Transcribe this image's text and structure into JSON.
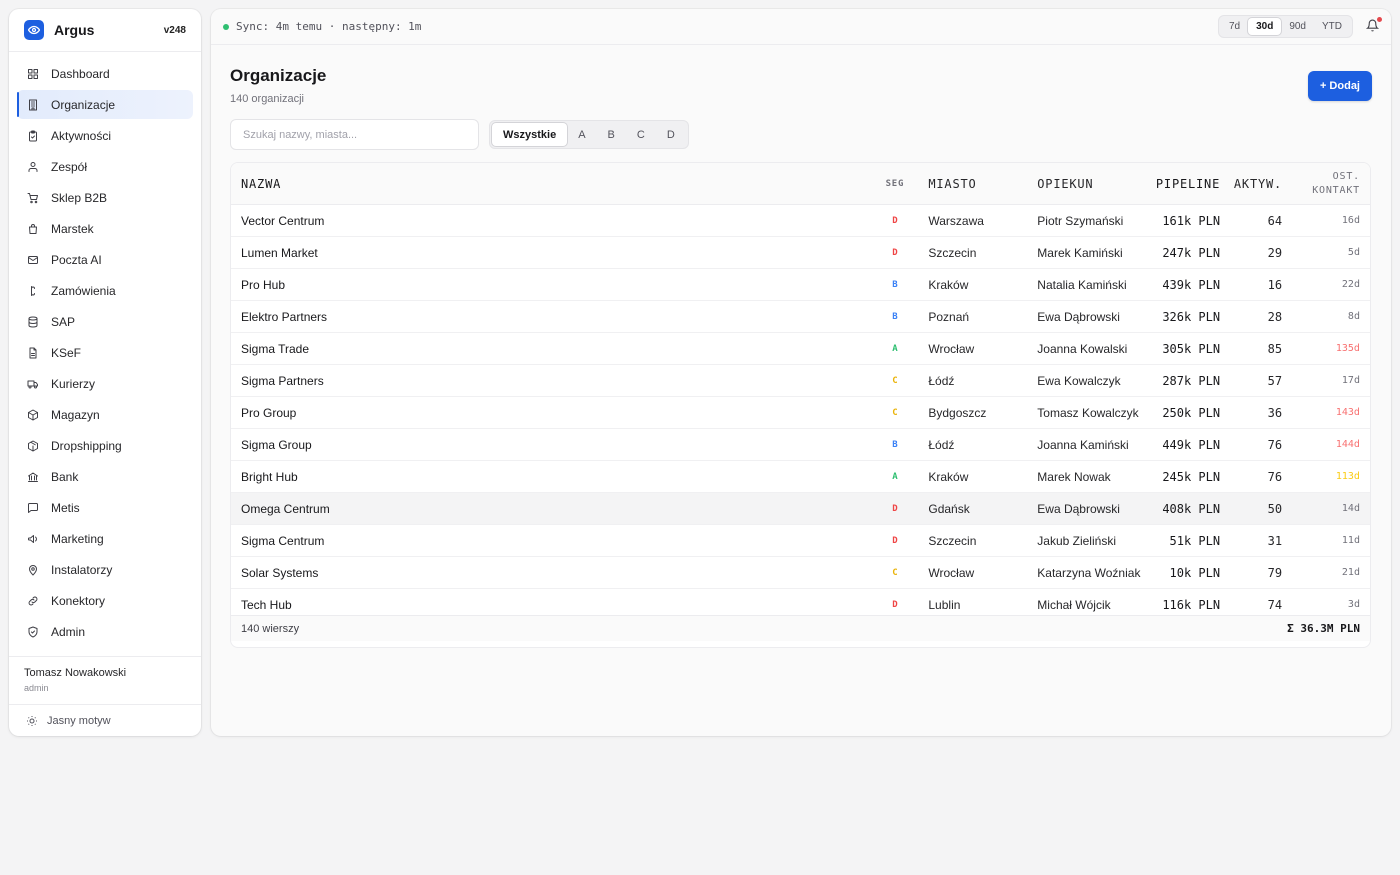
{
  "brand": {
    "name": "Argus",
    "version": "v248"
  },
  "sidebar": {
    "items": [
      {
        "label": "Dashboard",
        "icon": "grid-icon"
      },
      {
        "label": "Organizacje",
        "icon": "building-icon",
        "active": true
      },
      {
        "label": "Aktywności",
        "icon": "clipboard-icon"
      },
      {
        "label": "Zespół",
        "icon": "users-icon"
      },
      {
        "label": "Sklep B2B",
        "icon": "cart-icon"
      },
      {
        "label": "Marstek",
        "icon": "bag-icon"
      },
      {
        "label": "Poczta AI",
        "icon": "mail-icon"
      },
      {
        "label": "Zamówienia",
        "icon": "receipt-icon"
      },
      {
        "label": "SAP",
        "icon": "database-icon"
      },
      {
        "label": "KSeF",
        "icon": "file-icon"
      },
      {
        "label": "Kurierzy",
        "icon": "truck-icon"
      },
      {
        "label": "Magazyn",
        "icon": "box-icon"
      },
      {
        "label": "Dropshipping",
        "icon": "package-icon"
      },
      {
        "label": "Bank",
        "icon": "bank-icon"
      },
      {
        "label": "Metis",
        "icon": "chat-icon"
      },
      {
        "label": "Marketing",
        "icon": "megaphone-icon"
      },
      {
        "label": "Instalatorzy",
        "icon": "pin-icon"
      },
      {
        "label": "Konektory",
        "icon": "link-icon"
      },
      {
        "label": "Admin",
        "icon": "shield-icon"
      }
    ]
  },
  "user": {
    "name": "Tomasz Nowakowski",
    "role": "admin"
  },
  "theme_toggle": "Jasny motyw",
  "topbar": {
    "sync": "Sync: 4m temu · następny: 1m",
    "ranges": [
      "7d",
      "30d",
      "90d",
      "YTD"
    ],
    "selected_range": "30d"
  },
  "page": {
    "title": "Organizacje",
    "subtitle": "140 organizacji",
    "add_label": "+ Dodaj",
    "search_placeholder": "Szukaj nazwy, miasta...",
    "segments": [
      "Wszystkie",
      "A",
      "B",
      "C",
      "D"
    ],
    "selected_segment": "Wszystkie"
  },
  "colors": {
    "accent": "#1d5fe0",
    "seg_A": "#2fbf71",
    "seg_B": "#3b82f6",
    "seg_C": "#eab308",
    "seg_D": "#ef4444",
    "stale_red": "#f87171",
    "stale_amber": "#facc15"
  },
  "table": {
    "headers": {
      "name": "NAZWA",
      "seg": "SEG",
      "city": "MIASTO",
      "owner": "OPIEKUN",
      "pipeline": "PIPELINE",
      "activity": "AKTYW.",
      "last_contact_1": "OST.",
      "last_contact_2": "KONTAKT"
    },
    "rows": [
      {
        "name": "Vector Centrum",
        "seg": "D",
        "city": "Warszawa",
        "owner": "Piotr Szymański",
        "pipeline": "161k PLN",
        "activity": "64",
        "last": "16d",
        "status": "normal"
      },
      {
        "name": "Lumen Market",
        "seg": "D",
        "city": "Szczecin",
        "owner": "Marek Kamiński",
        "pipeline": "247k PLN",
        "activity": "29",
        "last": "5d",
        "status": "normal"
      },
      {
        "name": "Pro Hub",
        "seg": "B",
        "city": "Kraków",
        "owner": "Natalia Kamiński",
        "pipeline": "439k PLN",
        "activity": "16",
        "last": "22d",
        "status": "normal"
      },
      {
        "name": "Elektro Partners",
        "seg": "B",
        "city": "Poznań",
        "owner": "Ewa Dąbrowski",
        "pipeline": "326k PLN",
        "activity": "28",
        "last": "8d",
        "status": "normal"
      },
      {
        "name": "Sigma Trade",
        "seg": "A",
        "city": "Wrocław",
        "owner": "Joanna Kowalski",
        "pipeline": "305k PLN",
        "activity": "85",
        "last": "135d",
        "status": "red"
      },
      {
        "name": "Sigma Partners",
        "seg": "C",
        "city": "Łódź",
        "owner": "Ewa Kowalczyk",
        "pipeline": "287k PLN",
        "activity": "57",
        "last": "17d",
        "status": "normal"
      },
      {
        "name": "Pro Group",
        "seg": "C",
        "city": "Bydgoszcz",
        "owner": "Tomasz Kowalczyk",
        "pipeline": "250k PLN",
        "activity": "36",
        "last": "143d",
        "status": "red"
      },
      {
        "name": "Sigma Group",
        "seg": "B",
        "city": "Łódź",
        "owner": "Joanna Kamiński",
        "pipeline": "449k PLN",
        "activity": "76",
        "last": "144d",
        "status": "red"
      },
      {
        "name": "Bright Hub",
        "seg": "A",
        "city": "Kraków",
        "owner": "Marek Nowak",
        "pipeline": "245k PLN",
        "activity": "76",
        "last": "113d",
        "status": "amber"
      },
      {
        "name": "Omega Centrum",
        "seg": "D",
        "city": "Gdańsk",
        "owner": "Ewa Dąbrowski",
        "pipeline": "408k PLN",
        "activity": "50",
        "last": "14d",
        "status": "normal"
      },
      {
        "name": "Sigma Centrum",
        "seg": "D",
        "city": "Szczecin",
        "owner": "Jakub Zieliński",
        "pipeline": "51k PLN",
        "activity": "31",
        "last": "11d",
        "status": "normal"
      },
      {
        "name": "Solar Systems",
        "seg": "C",
        "city": "Wrocław",
        "owner": "Katarzyna Woźniak",
        "pipeline": "10k PLN",
        "activity": "79",
        "last": "21d",
        "status": "normal"
      },
      {
        "name": "Tech Hub",
        "seg": "D",
        "city": "Lublin",
        "owner": "Michał Wójcik",
        "pipeline": "116k PLN",
        "activity": "74",
        "last": "3d",
        "status": "normal"
      }
    ],
    "footer_count": "140 wierszy",
    "footer_sum": "Σ 36.3M PLN"
  }
}
